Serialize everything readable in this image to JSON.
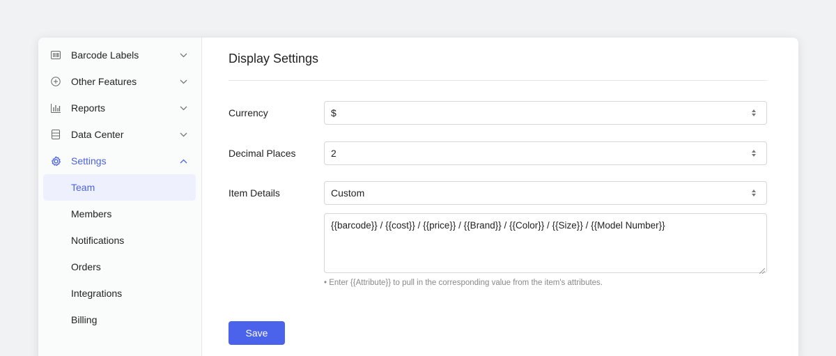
{
  "sidebar": {
    "items": [
      {
        "label": "Barcode Labels",
        "icon": "barcode-icon",
        "expanded": false
      },
      {
        "label": "Other Features",
        "icon": "plus-circle-icon",
        "expanded": false
      },
      {
        "label": "Reports",
        "icon": "bar-chart-icon",
        "expanded": false
      },
      {
        "label": "Data Center",
        "icon": "database-icon",
        "expanded": false
      },
      {
        "label": "Settings",
        "icon": "gear-icon",
        "expanded": true
      }
    ],
    "sub_items": [
      {
        "label": "Team",
        "selected": true
      },
      {
        "label": "Members"
      },
      {
        "label": "Notifications"
      },
      {
        "label": "Orders"
      },
      {
        "label": "Integrations"
      },
      {
        "label": "Billing"
      }
    ]
  },
  "main": {
    "title": "Display Settings",
    "currency": {
      "label": "Currency",
      "value": "$"
    },
    "decimal_places": {
      "label": "Decimal Places",
      "value": "2"
    },
    "item_details": {
      "label": "Item Details",
      "value": "Custom",
      "template": "{{barcode}} / {{cost}} / {{price}} / {{Brand}} / {{Color}} / {{Size}} / {{Model Number}}",
      "hint": "• Enter {{Attribute}} to pull in the corresponding value from the item's attributes."
    },
    "save_label": "Save"
  },
  "colors": {
    "accent": "#4a63e0",
    "button": "#4a63ea",
    "background": "#f1f2f4"
  }
}
